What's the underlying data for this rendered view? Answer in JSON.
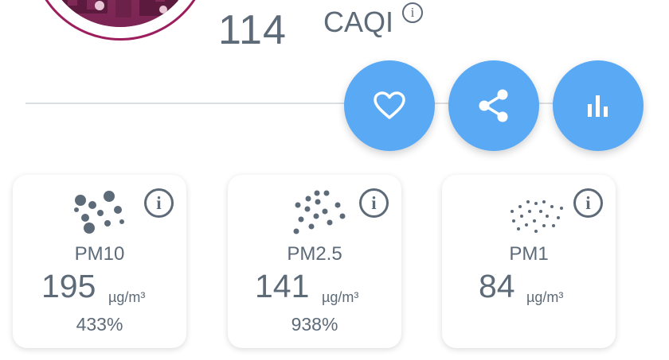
{
  "index": {
    "value": "114",
    "unit": "CAQI",
    "info_glyph": "i"
  },
  "actions": {
    "favorite_icon": "heart-icon",
    "share_icon": "share-icon",
    "chart_icon": "bar-chart-icon",
    "accent_color": "#5aa9f5"
  },
  "pollutants": [
    {
      "label": "PM10",
      "value": "195",
      "unit": "µg/m³",
      "percent": "433%",
      "icon": "large-particles-icon"
    },
    {
      "label": "PM2.5",
      "value": "141",
      "unit": "µg/m³",
      "percent": "938%",
      "icon": "medium-particles-icon"
    },
    {
      "label": "PM1",
      "value": "84",
      "unit": "µg/m³",
      "percent": "",
      "icon": "small-particles-icon"
    }
  ],
  "info_glyph": "i",
  "colors": {
    "text": "#5d6a78",
    "avatar_ring": "#9d1e5c"
  }
}
